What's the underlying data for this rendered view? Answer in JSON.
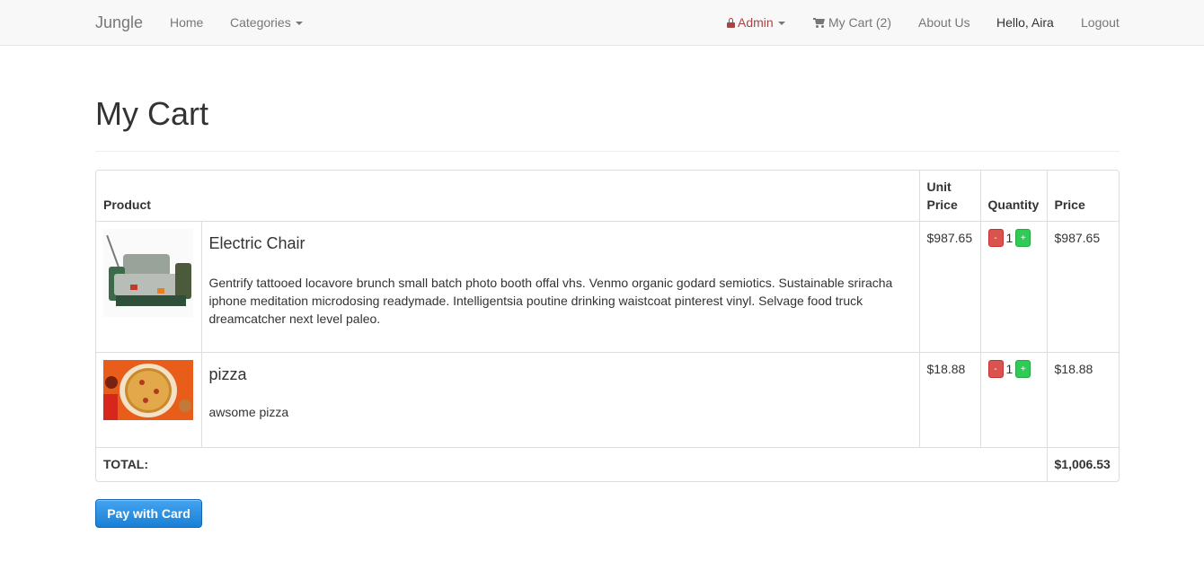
{
  "navbar": {
    "brand": "Jungle",
    "home": "Home",
    "categories": "Categories",
    "admin": "Admin",
    "cart": "My Cart (2)",
    "about": "About Us",
    "greeting": "Hello, Aira",
    "logout": "Logout"
  },
  "page": {
    "title": "My Cart"
  },
  "table": {
    "headers": {
      "product": "Product",
      "unit_price": "Unit Price",
      "quantity": "Quantity",
      "price": "Price"
    },
    "rows": [
      {
        "name": "Electric Chair",
        "description": "Gentrify tattooed locavore brunch small batch photo booth offal vhs. Venmo organic godard semiotics. Sustainable sriracha iphone meditation microdosing readymade. Intelligentsia poutine drinking waistcoat pinterest vinyl. Selvage food truck dreamcatcher next level paleo.",
        "unit_price": "$987.65",
        "quantity": "1",
        "price": "$987.65",
        "minus": "-",
        "plus": "+"
      },
      {
        "name": "pizza",
        "description": "awsome pizza",
        "unit_price": "$18.88",
        "quantity": "1",
        "price": "$18.88",
        "minus": "-",
        "plus": "+"
      }
    ],
    "total_label": "TOTAL:",
    "total_value": "$1,006.53"
  },
  "pay_button": "Pay with Card",
  "colors": {
    "admin": "#a94442",
    "pay": "#1a7fd6",
    "minus": "#d9534f",
    "plus": "#2ecc54"
  }
}
